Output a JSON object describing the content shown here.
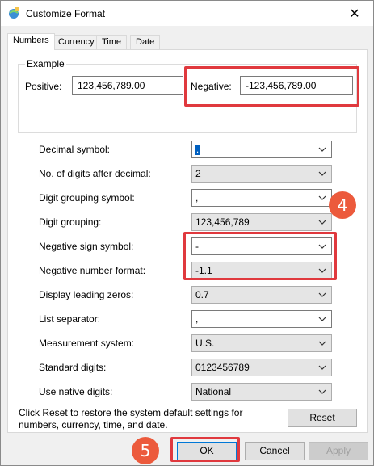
{
  "window": {
    "title": "Customize Format",
    "close_glyph": "✕"
  },
  "tabs": [
    {
      "label": "Numbers",
      "active": true
    },
    {
      "label": "Currency",
      "active": false
    },
    {
      "label": "Time",
      "active": false
    },
    {
      "label": "Date",
      "active": false
    }
  ],
  "example": {
    "group_label": "Example",
    "positive_label": "Positive:",
    "positive_value": "123,456,789.00",
    "negative_label": "Negative:",
    "negative_value": "-123,456,789.00"
  },
  "settings": [
    {
      "label": "Decimal symbol:",
      "value": ".",
      "editable": true
    },
    {
      "label": "No. of digits after decimal:",
      "value": "2",
      "editable": false
    },
    {
      "label": "Digit grouping symbol:",
      "value": ",",
      "editable": true
    },
    {
      "label": "Digit grouping:",
      "value": "123,456,789",
      "editable": false
    },
    {
      "label": "Negative sign symbol:",
      "value": "-",
      "editable": true
    },
    {
      "label": "Negative number format:",
      "value": "-1.1",
      "editable": false
    },
    {
      "label": "Display leading zeros:",
      "value": "0.7",
      "editable": false
    },
    {
      "label": "List separator:",
      "value": ",",
      "editable": true
    },
    {
      "label": "Measurement system:",
      "value": "U.S.",
      "editable": false
    },
    {
      "label": "Standard digits:",
      "value": "0123456789",
      "editable": false
    },
    {
      "label": "Use native digits:",
      "value": "National",
      "editable": false
    }
  ],
  "reset": {
    "text": "Click Reset to restore the system default settings for numbers, currency, time, and date.",
    "button": "Reset"
  },
  "buttons": {
    "ok": "OK",
    "cancel": "Cancel",
    "apply": "Apply"
  },
  "annotations": {
    "badge4": "4",
    "badge5": "5"
  },
  "colors": {
    "highlight": "#e0393e",
    "badge": "#ec5a3c",
    "focus": "#0078d7"
  }
}
